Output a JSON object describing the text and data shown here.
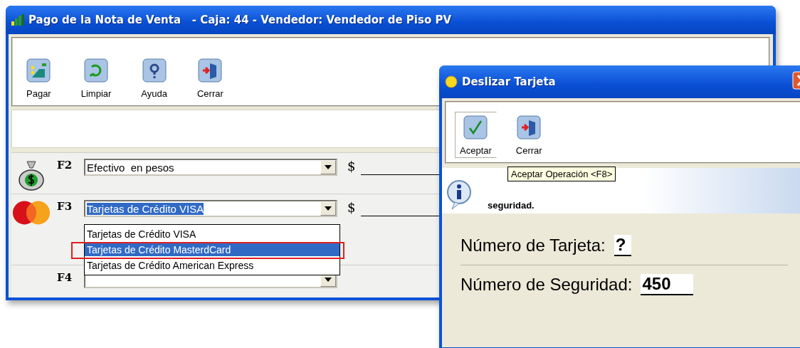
{
  "main_window": {
    "title": "Pago de la Nota de Venta   - Caja: 44 - Vendedor: Vendedor de Piso PV",
    "toolbar": [
      {
        "kind": "pay",
        "label": "Pagar"
      },
      {
        "kind": "clear",
        "label": "Limpiar"
      },
      {
        "kind": "help",
        "label": "Ayuda"
      },
      {
        "kind": "close",
        "label": "Cerrar"
      }
    ],
    "payments": [
      {
        "key": "F2",
        "kind": "cash",
        "method": "Efectivo  en pesos",
        "method_highlighted": false,
        "currency": "$"
      },
      {
        "key": "F3",
        "kind": "card",
        "method": "Tarjetas de Crédito VISA",
        "method_highlighted": true,
        "currency": "$",
        "options": [
          {
            "label": "Tarjetas de Crédito VISA",
            "selected": false
          },
          {
            "label": "Tarjetas de Crédito MasterdCard",
            "selected": true
          },
          {
            "label": "Tarjetas de Crédito American Express",
            "selected": false
          }
        ]
      },
      {
        "key": "F4",
        "kind": "none"
      }
    ]
  },
  "dialog": {
    "title": "Deslizar Tarjeta",
    "toolbar": [
      {
        "kind": "accept",
        "label": "Aceptar",
        "pressed": true
      },
      {
        "kind": "close",
        "label": "Cerrar",
        "pressed": false
      }
    ],
    "tooltip": "Aceptar Operación <F8>",
    "info": "seguridad.",
    "fields": [
      {
        "label": "Número de Tarjeta:",
        "value": "?"
      },
      {
        "label": "Número de Seguridad:",
        "value": "450"
      }
    ]
  }
}
